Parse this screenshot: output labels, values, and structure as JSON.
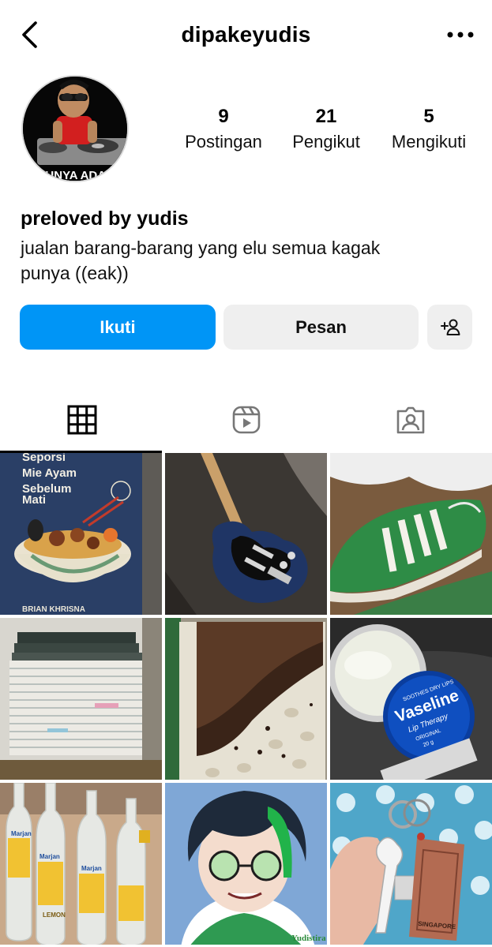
{
  "header": {
    "username": "dipakeyudis",
    "back_icon": "chevron-left-icon",
    "more_icon": "more-horizontal-icon"
  },
  "profile": {
    "avatar_caption": "PUNYA ADAM",
    "stats": [
      {
        "value": "9",
        "label": "Postingan"
      },
      {
        "value": "21",
        "label": "Pengikut"
      },
      {
        "value": "5",
        "label": "Mengikuti"
      }
    ],
    "name": "preloved by yudis",
    "bio_line1": "jualan barang-barang yang elu semua kagak",
    "bio_line2": "punya ((eak))"
  },
  "actions": {
    "follow_label": "Ikuti",
    "message_label": "Pesan",
    "add_user_icon": "add-person-icon"
  },
  "tabs": [
    {
      "icon": "grid-icon",
      "active": true
    },
    {
      "icon": "reels-icon",
      "active": false
    },
    {
      "icon": "tagged-icon",
      "active": false
    }
  ],
  "posts": {
    "book_title_1": "Seporsi",
    "book_title_2": "Mie Ayam",
    "book_title_3": "Sebelum",
    "book_title_4": "Mati",
    "book_author": "BRIAN KHRISNA",
    "vaseline_brand": "Vaseline",
    "vaseline_sub": "Lip Therapy",
    "vaseline_top": "SOOTHES DRY LIPS",
    "vaseline_orig": "ORIGINAL",
    "vaseline_weight": "20 g",
    "keychain_text": "SINGAPORE",
    "syrup_brand": "Marjan",
    "syrup_flavor": "LEMON"
  },
  "colors": {
    "accent": "#0095f6",
    "secondary_button": "#efefef",
    "text": "#000000"
  }
}
